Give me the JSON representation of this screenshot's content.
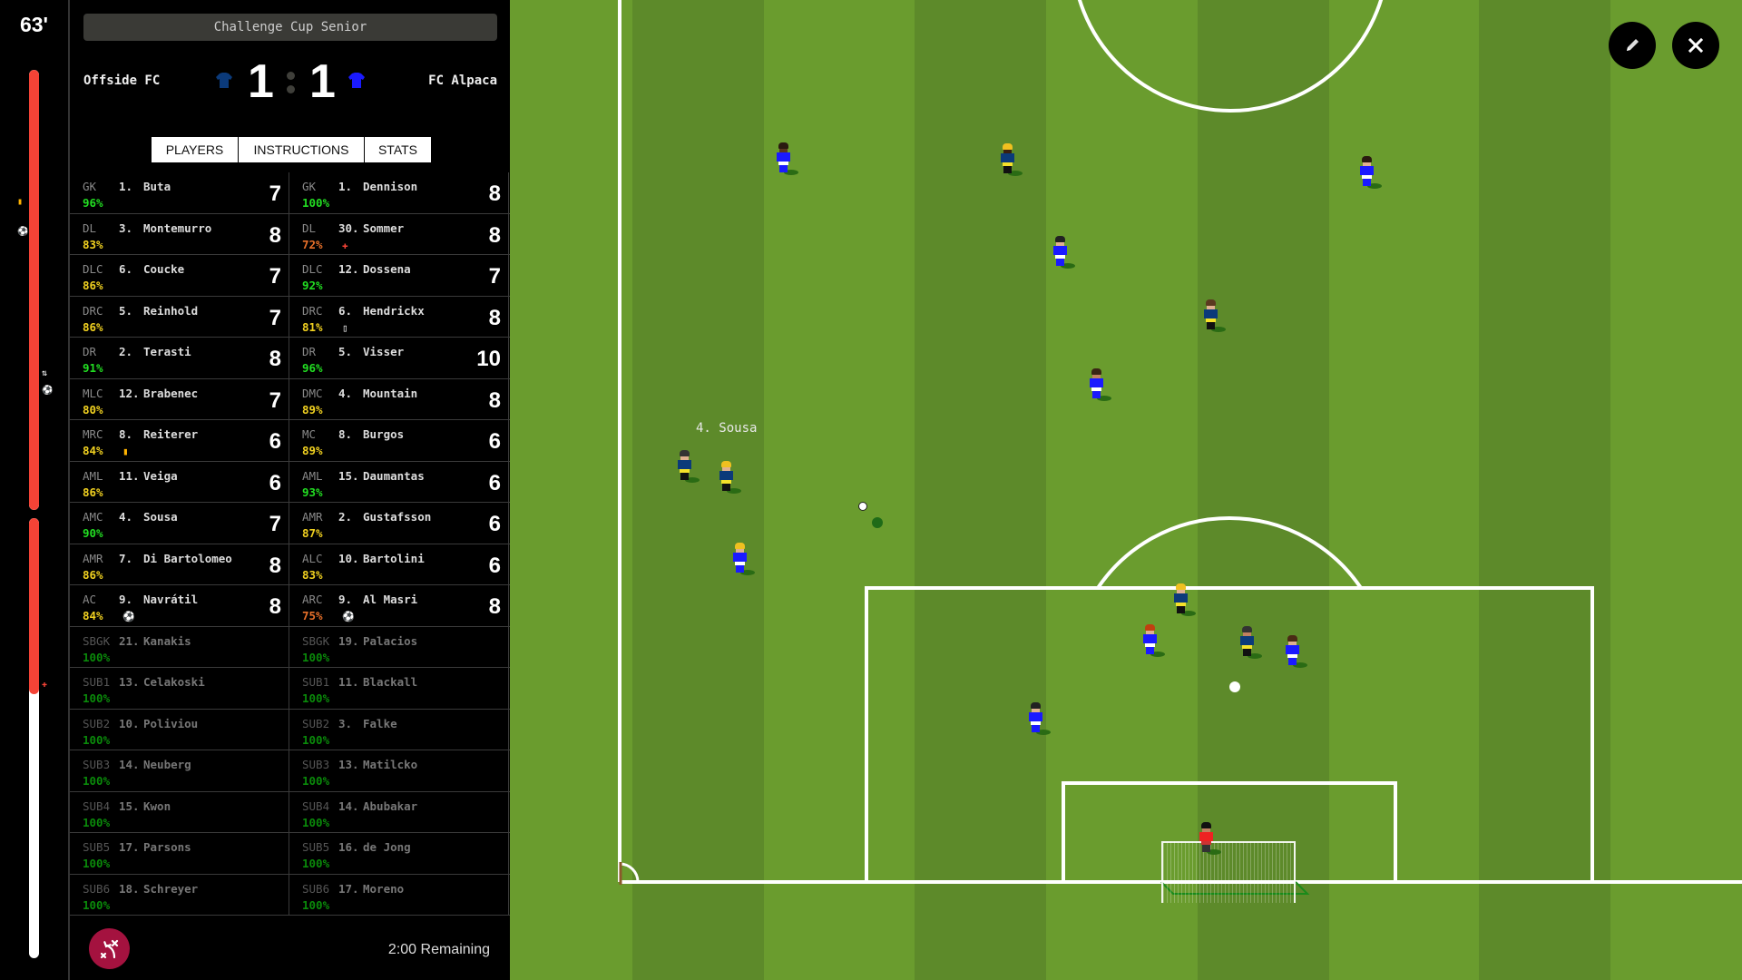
{
  "match": {
    "minute": "63'",
    "competition": "Challenge Cup Senior",
    "home": {
      "name": "Offside FC",
      "score": "1",
      "shirt_color": "#0b3a7a",
      "shorts_color": "#f5e12a"
    },
    "away": {
      "name": "FC Alpaca",
      "score": "1",
      "shirt_color": "#1a1aff",
      "shorts_color": "#ffffff"
    },
    "remaining": "2:00 Remaining",
    "first_half_progress": 1.0,
    "second_half_progress": 0.4
  },
  "timeline_events": [
    {
      "half": 1,
      "at": 0.3,
      "side": "home",
      "icon": "yellow-card-icon",
      "glyph": "▮",
      "color": "#ffb300"
    },
    {
      "half": 1,
      "at": 0.37,
      "side": "home",
      "icon": "goal-ball-icon",
      "glyph": "⚽",
      "color": "#ffffff"
    },
    {
      "half": 1,
      "at": 0.69,
      "side": "away",
      "icon": "substitution-icon",
      "glyph": "⇅",
      "color": "#ffffff"
    },
    {
      "half": 1,
      "at": 0.73,
      "side": "away",
      "icon": "goal-ball-icon",
      "glyph": "⚽",
      "color": "#ffffff"
    },
    {
      "half": 2,
      "at": 0.38,
      "side": "away",
      "icon": "injury-cross-icon",
      "glyph": "✚",
      "color": "#f44336"
    }
  ],
  "tabs": [
    {
      "label": "PLAYERS",
      "active": true
    },
    {
      "label": "INSTRUCTIONS",
      "active": false
    },
    {
      "label": "STATS",
      "active": false
    }
  ],
  "home_players": [
    {
      "pos": "GK",
      "cond": "96%",
      "cond_color": "#22dd22",
      "num": "1.",
      "name": "Buta",
      "rating": "7"
    },
    {
      "pos": "DL",
      "cond": "83%",
      "cond_color": "#f0d020",
      "num": "3.",
      "name": "Montemurro",
      "rating": "8"
    },
    {
      "pos": "DLC",
      "cond": "86%",
      "cond_color": "#f0d020",
      "num": "6.",
      "name": "Coucke",
      "rating": "7"
    },
    {
      "pos": "DRC",
      "cond": "86%",
      "cond_color": "#f0d020",
      "num": "5.",
      "name": "Reinhold",
      "rating": "7"
    },
    {
      "pos": "DR",
      "cond": "91%",
      "cond_color": "#22dd22",
      "num": "2.",
      "name": "Terasti",
      "rating": "8"
    },
    {
      "pos": "MLC",
      "cond": "80%",
      "cond_color": "#f0d020",
      "num": "12.",
      "name": "Brabenec",
      "rating": "7"
    },
    {
      "pos": "MRC",
      "cond": "84%",
      "cond_color": "#f0d020",
      "num": "8.",
      "name": "Reiterer",
      "rating": "6",
      "status": {
        "icon": "yellow-card-icon",
        "glyph": "▮",
        "color": "#ffb300"
      }
    },
    {
      "pos": "AML",
      "cond": "86%",
      "cond_color": "#f0d020",
      "num": "11.",
      "name": "Veiga",
      "rating": "6"
    },
    {
      "pos": "AMC",
      "cond": "90%",
      "cond_color": "#22dd22",
      "num": "4.",
      "name": "Sousa",
      "rating": "7"
    },
    {
      "pos": "AMR",
      "cond": "86%",
      "cond_color": "#f0d020",
      "num": "7.",
      "name": "Di Bartolomeo",
      "rating": "8"
    },
    {
      "pos": "AC",
      "cond": "84%",
      "cond_color": "#f0d020",
      "num": "9.",
      "name": "Navrátil",
      "rating": "8",
      "status": {
        "icon": "goal-ball-icon",
        "glyph": "⚽",
        "color": "#ffffff"
      }
    },
    {
      "pos": "SBGK",
      "cond": "100%",
      "num": "21.",
      "name": "Kanakis",
      "rating": "",
      "sub": true
    },
    {
      "pos": "SUB1",
      "cond": "100%",
      "num": "13.",
      "name": "Celakoski",
      "rating": "",
      "sub": true
    },
    {
      "pos": "SUB2",
      "cond": "100%",
      "num": "10.",
      "name": "Poliviou",
      "rating": "",
      "sub": true
    },
    {
      "pos": "SUB3",
      "cond": "100%",
      "num": "14.",
      "name": "Neuberg",
      "rating": "",
      "sub": true
    },
    {
      "pos": "SUB4",
      "cond": "100%",
      "num": "15.",
      "name": "Kwon",
      "rating": "",
      "sub": true
    },
    {
      "pos": "SUB5",
      "cond": "100%",
      "num": "17.",
      "name": "Parsons",
      "rating": "",
      "sub": true
    },
    {
      "pos": "SUB6",
      "cond": "100%",
      "num": "18.",
      "name": "Schreyer",
      "rating": "",
      "sub": true
    }
  ],
  "away_players": [
    {
      "pos": "GK",
      "cond": "100%",
      "cond_color": "#22dd22",
      "num": "1.",
      "name": "Dennison",
      "rating": "8"
    },
    {
      "pos": "DL",
      "cond": "72%",
      "cond_color": "#e8702a",
      "num": "30.",
      "name": "Sommer",
      "rating": "8",
      "status": {
        "icon": "injury-cross-icon",
        "glyph": "✚",
        "color": "#f44336"
      }
    },
    {
      "pos": "DLC",
      "cond": "92%",
      "cond_color": "#22dd22",
      "num": "12.",
      "name": "Dossena",
      "rating": "7"
    },
    {
      "pos": "DRC",
      "cond": "81%",
      "cond_color": "#f0d020",
      "num": "6.",
      "name": "Hendrickx",
      "rating": "8",
      "status": {
        "icon": "substitution-icon",
        "glyph": "▯",
        "color": "#ffffff"
      }
    },
    {
      "pos": "DR",
      "cond": "96%",
      "cond_color": "#22dd22",
      "num": "5.",
      "name": "Visser",
      "rating": "10"
    },
    {
      "pos": "DMC",
      "cond": "89%",
      "cond_color": "#f0d020",
      "num": "4.",
      "name": "Mountain",
      "rating": "8"
    },
    {
      "pos": "MC",
      "cond": "89%",
      "cond_color": "#f0d020",
      "num": "8.",
      "name": "Burgos",
      "rating": "6"
    },
    {
      "pos": "AML",
      "cond": "93%",
      "cond_color": "#22dd22",
      "num": "15.",
      "name": "Daumantas",
      "rating": "6"
    },
    {
      "pos": "AMR",
      "cond": "87%",
      "cond_color": "#f0d020",
      "num": "2.",
      "name": "Gustafsson",
      "rating": "6"
    },
    {
      "pos": "ALC",
      "cond": "83%",
      "cond_color": "#f0d020",
      "num": "10.",
      "name": "Bartolini",
      "rating": "6"
    },
    {
      "pos": "ARC",
      "cond": "75%",
      "cond_color": "#e8702a",
      "num": "9.",
      "name": "Al Masri",
      "rating": "8",
      "status": {
        "icon": "goal-ball-icon",
        "glyph": "⚽",
        "color": "#ffffff"
      }
    },
    {
      "pos": "SBGK",
      "cond": "100%",
      "num": "19.",
      "name": "Palacios",
      "rating": "",
      "sub": true
    },
    {
      "pos": "SUB1",
      "cond": "100%",
      "num": "11.",
      "name": "Blackall",
      "rating": "",
      "sub": true
    },
    {
      "pos": "SUB2",
      "cond": "100%",
      "num": "3.",
      "name": "Falke",
      "rating": "",
      "sub": true
    },
    {
      "pos": "SUB3",
      "cond": "100%",
      "num": "13.",
      "name": "Matilcko",
      "rating": "",
      "sub": true
    },
    {
      "pos": "SUB4",
      "cond": "100%",
      "num": "14.",
      "name": "Abubakar",
      "rating": "",
      "sub": true
    },
    {
      "pos": "SUB5",
      "cond": "100%",
      "num": "16.",
      "name": "de Jong",
      "rating": "",
      "sub": true
    },
    {
      "pos": "SUB6",
      "cond": "100%",
      "num": "17.",
      "name": "Moreno",
      "rating": "",
      "sub": true
    }
  ],
  "pitch": {
    "selected_player_label": "4. Sousa",
    "colors": {
      "grass_light": "#6a9c2e",
      "grass_dark": "#5d8a2a",
      "lines": "#ffffff"
    },
    "players": [
      {
        "team": "away",
        "hair": "#2a1a10",
        "skin": "#5a3520"
      },
      {
        "team": "home",
        "hair": "#f0c020",
        "skin": "#3a2010"
      },
      {
        "team": "away",
        "hair": "#2a1a10",
        "skin": "#e0b090"
      },
      {
        "team": "away",
        "hair": "#222222",
        "skin": "#e0b090"
      },
      {
        "team": "home",
        "hair": "#5a3a20",
        "skin": "#e0b090"
      },
      {
        "team": "away",
        "hair": "#3a2515",
        "skin": "#c08060"
      },
      {
        "team": "home",
        "hair": "#333333",
        "skin": "#e0b090"
      },
      {
        "team": "home",
        "hair": "#f0c020",
        "skin": "#e0b090"
      },
      {
        "team": "away",
        "hair": "#f0c020",
        "skin": "#e0b090"
      },
      {
        "team": "home",
        "hair": "#f0c020",
        "skin": "#e0b090"
      },
      {
        "team": "away",
        "hair": "#c04010",
        "skin": "#e0b090"
      },
      {
        "team": "home",
        "hair": "#333333",
        "skin": "#c08060"
      },
      {
        "team": "away",
        "hair": "#4a2a15",
        "skin": "#e0b090"
      },
      {
        "team": "away",
        "hair": "#222222",
        "skin": "#e0b090"
      },
      {
        "team": "gk",
        "hair": "#111111",
        "skin": "#c08060"
      }
    ]
  },
  "controls": {
    "edit_icon": "pencil-icon",
    "close_icon": "close-icon",
    "tactics_icon": "tactics-board-icon"
  }
}
